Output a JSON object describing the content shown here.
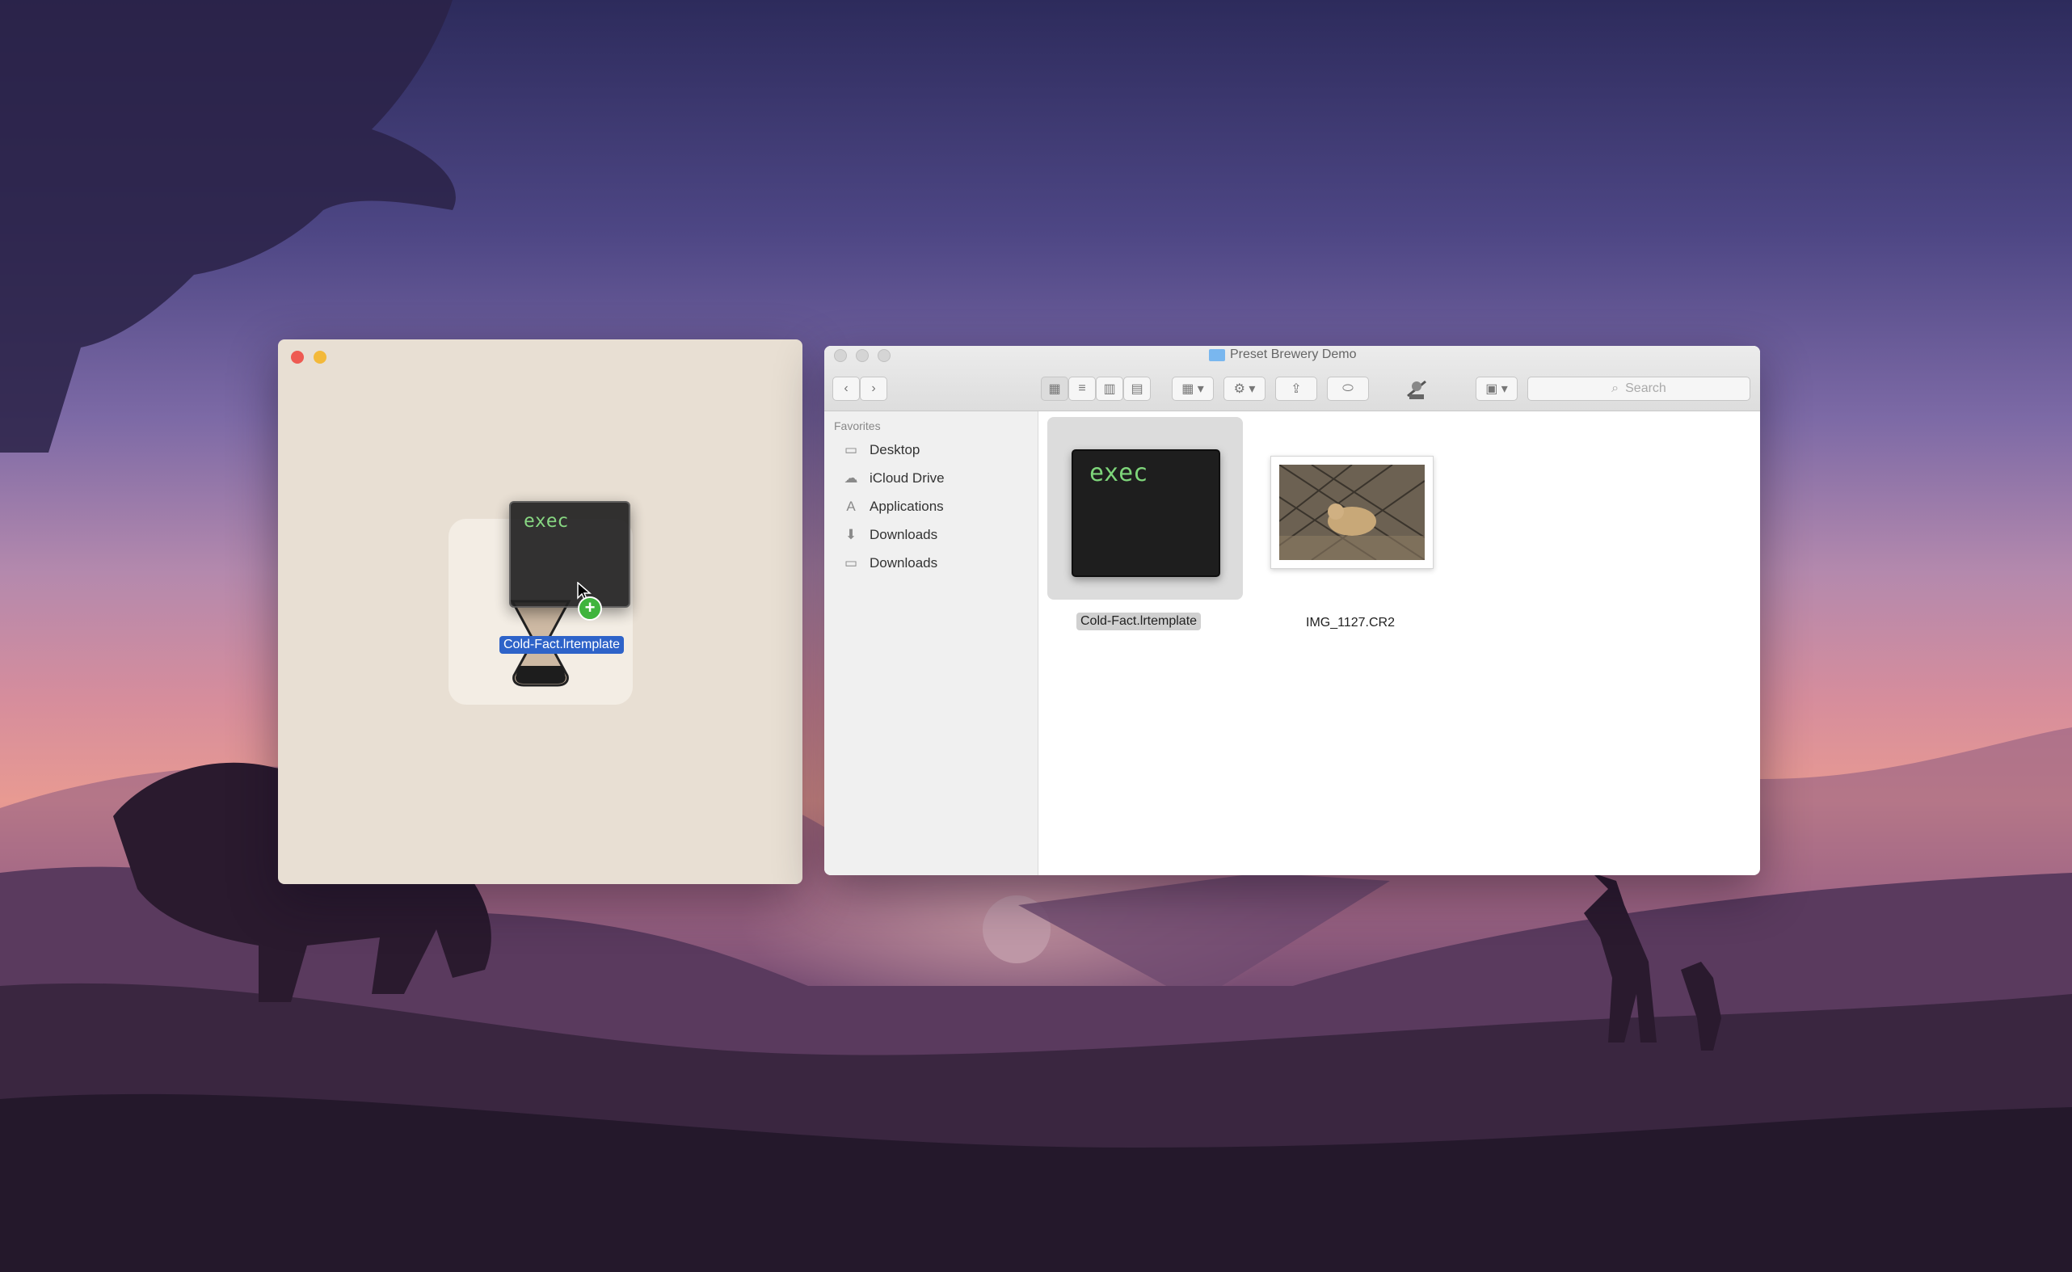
{
  "app_window": {
    "drag_icon_text": "exec",
    "drag_label": "Cold-Fact.lrtemplate"
  },
  "finder": {
    "title": "Preset Brewery Demo",
    "search_placeholder": "Search",
    "sidebar": {
      "header": "Favorites",
      "items": [
        {
          "label": "Desktop",
          "icon": "desktop-icon"
        },
        {
          "label": "iCloud Drive",
          "icon": "cloud-icon"
        },
        {
          "label": "Applications",
          "icon": "applications-icon"
        },
        {
          "label": "Downloads",
          "icon": "download-circle-icon"
        },
        {
          "label": "Downloads",
          "icon": "folder-icon"
        }
      ]
    },
    "files": [
      {
        "name": "Cold-Fact.lrtemplate",
        "icon_text": "exec",
        "selected": true
      },
      {
        "name": "IMG_1127.CR2",
        "selected": false
      }
    ]
  }
}
